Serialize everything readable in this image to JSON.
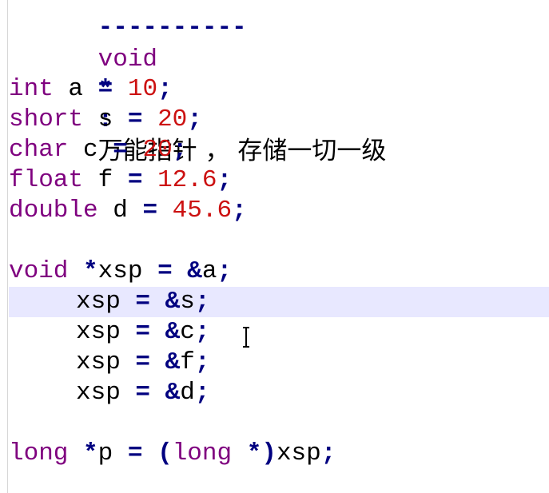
{
  "code": {
    "dashes": "----------",
    "header": {
      "kw": "void",
      "star": "*",
      "colon": ":",
      "text": "万能指针 ， 存储一切一级"
    },
    "lines": [
      {
        "type": "int",
        "name": "a",
        "eq": "=",
        "value": "10",
        "semi": ";"
      },
      {
        "type": "short",
        "name": "s",
        "eq": "=",
        "value": "20",
        "semi": ";"
      },
      {
        "type": "char",
        "name": "c",
        "eq": "=",
        "value": "20",
        "semi": ";"
      },
      {
        "type": "float",
        "name": "f",
        "eq": "=",
        "value": "12.6",
        "semi": ";"
      },
      {
        "type": "double",
        "name": "d",
        "eq": "=",
        "value": "45.6",
        "semi": ";"
      }
    ],
    "decl": {
      "kw": "void",
      "star": "*",
      "name": "xsp",
      "eq": "=",
      "amp": "&",
      "target": "a",
      "semi": ";"
    },
    "assigns": [
      {
        "name": "xsp",
        "eq": "=",
        "amp": "&",
        "target": "s",
        "semi": ";"
      },
      {
        "name": "xsp",
        "eq": "=",
        "amp": "&",
        "target": "c",
        "semi": ";"
      },
      {
        "name": "xsp",
        "eq": "=",
        "amp": "&",
        "target": "f",
        "semi": ";"
      },
      {
        "name": "xsp",
        "eq": "=",
        "amp": "&",
        "target": "d",
        "semi": ";"
      }
    ],
    "cast": {
      "kw": "long",
      "star": "*",
      "name": "p",
      "eq": "=",
      "lparen": "(",
      "castkw": "long",
      "caststar": "*",
      "rparen": ")",
      "src": "xsp",
      "semi": ";"
    }
  },
  "colors": {
    "keyword": "#7f007f",
    "number": "#cc1111",
    "operator": "#000080",
    "highlight": "#e8e8ff"
  }
}
